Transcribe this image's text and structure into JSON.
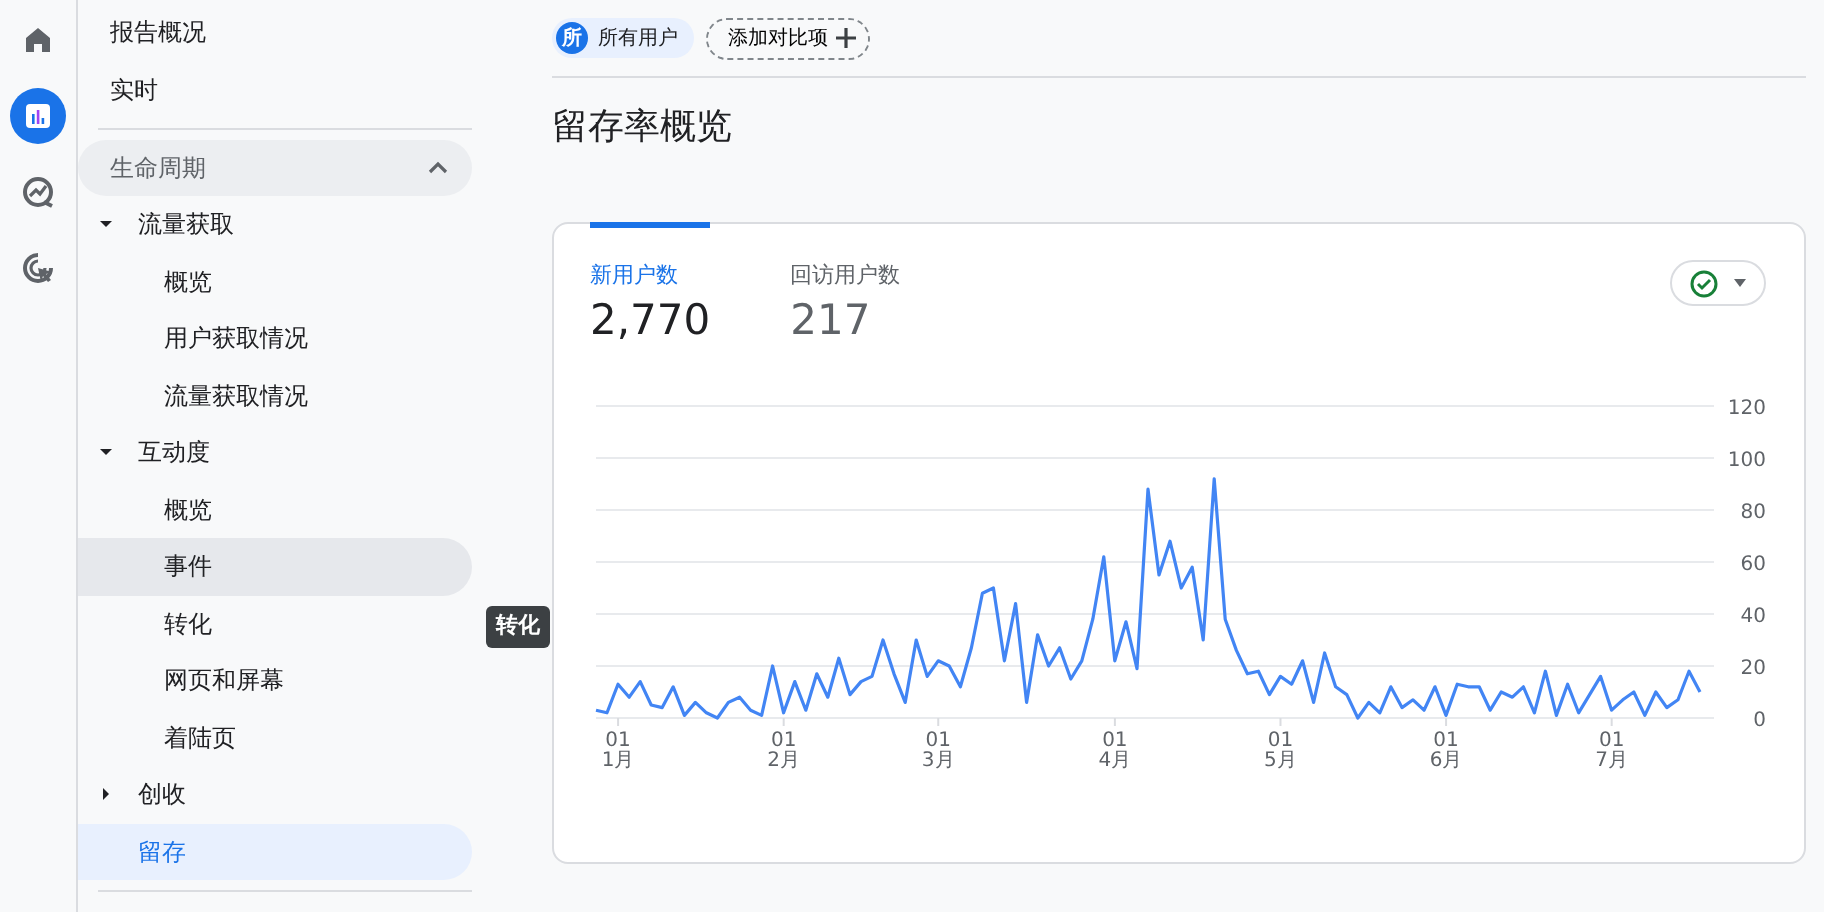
{
  "nav_rail": [
    {
      "kind": "home",
      "selected": false
    },
    {
      "kind": "reports",
      "selected": true
    },
    {
      "kind": "explore",
      "selected": false
    },
    {
      "kind": "advertising",
      "selected": false
    }
  ],
  "sidebar": {
    "top_items": [
      {
        "label": "报告概况"
      },
      {
        "label": "实时"
      }
    ],
    "section": {
      "label": "生命周期",
      "expanded": true
    },
    "tree": [
      {
        "label": "流量获取",
        "expanded": true,
        "selected": false,
        "children": [
          {
            "label": "概览",
            "selected": false,
            "hovered": false
          },
          {
            "label": "用户获取情况",
            "selected": false,
            "hovered": false
          },
          {
            "label": "流量获取情况",
            "selected": false,
            "hovered": false
          }
        ]
      },
      {
        "label": "互动度",
        "expanded": true,
        "selected": false,
        "children": [
          {
            "label": "概览",
            "selected": false,
            "hovered": false
          },
          {
            "label": "事件",
            "selected": false,
            "hovered": true
          },
          {
            "label": "转化",
            "selected": false,
            "hovered": false
          },
          {
            "label": "网页和屏幕",
            "selected": false,
            "hovered": false
          },
          {
            "label": "着陆页",
            "selected": false,
            "hovered": false
          }
        ]
      },
      {
        "label": "创收",
        "expanded": false,
        "selected": false
      },
      {
        "label": "留存",
        "selected": true
      }
    ]
  },
  "tooltip": {
    "text": "转化"
  },
  "comparisons": {
    "segments": [
      {
        "badge": "所",
        "label": "所有用户"
      }
    ],
    "add_label": "添加对比项"
  },
  "page_title": "留存率概览",
  "card": {
    "tabs": [
      {
        "label": "新用户数",
        "value": "2,770",
        "selected": true
      },
      {
        "label": "回访用户数",
        "value": "217",
        "selected": false
      }
    ],
    "chart_data": {
      "type": "line",
      "grid": true,
      "ylim": [
        0,
        120
      ],
      "yticks": [
        0,
        20,
        40,
        60,
        80,
        100,
        120
      ],
      "categories": [
        null,
        null,
        "01 1月",
        null,
        null,
        null,
        null,
        null,
        null,
        null,
        null,
        null,
        null,
        null,
        null,
        null,
        null,
        "01 2月",
        null,
        null,
        null,
        null,
        null,
        null,
        null,
        null,
        null,
        null,
        null,
        null,
        null,
        "01 3月",
        null,
        null,
        null,
        null,
        null,
        null,
        null,
        null,
        null,
        null,
        null,
        null,
        null,
        null,
        null,
        "01 4月",
        null,
        null,
        null,
        null,
        null,
        null,
        null,
        null,
        null,
        null,
        null,
        null,
        null,
        null,
        "01 5月",
        null,
        null,
        null,
        null,
        null,
        null,
        null,
        null,
        null,
        null,
        null,
        null,
        null,
        null,
        "01 6月",
        null,
        null,
        null,
        null,
        null,
        null,
        null,
        null,
        null,
        null,
        null,
        null,
        null,
        null,
        "01 7月",
        null,
        null,
        null,
        null,
        null,
        null,
        null,
        null
      ],
      "series": [
        {
          "color": "#4285f4",
          "values": [
            3,
            2,
            13,
            8,
            14,
            5,
            4,
            12,
            1,
            6,
            2,
            0,
            6,
            8,
            3,
            1,
            20,
            2,
            14,
            3,
            17,
            8,
            23,
            9,
            14,
            16,
            30,
            17,
            6,
            30,
            16,
            22,
            20,
            12,
            27,
            48,
            50,
            22,
            44,
            6,
            32,
            20,
            27,
            15,
            22,
            38,
            62,
            22,
            37,
            19,
            88,
            55,
            68,
            50,
            58,
            30,
            92,
            38,
            26,
            17,
            18,
            9,
            16,
            13,
            22,
            6,
            25,
            12,
            9,
            0,
            6,
            2,
            12,
            4,
            7,
            3,
            12,
            1,
            13,
            12,
            12,
            3,
            10,
            8,
            12,
            2,
            18,
            1,
            13,
            2,
            9,
            16,
            3,
            7,
            10,
            1,
            10,
            4,
            7,
            18,
            10
          ]
        }
      ]
    }
  }
}
